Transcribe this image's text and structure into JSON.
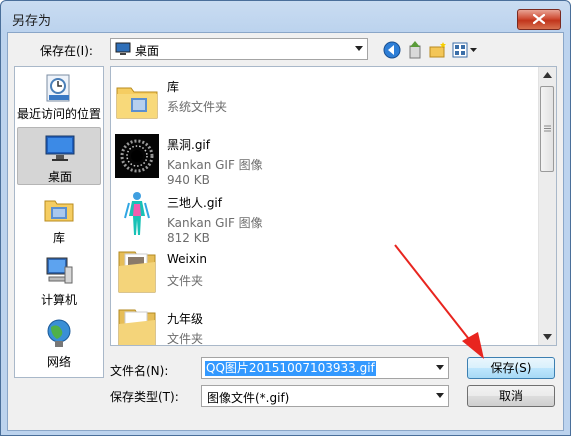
{
  "window": {
    "title": "另存为",
    "close_icon": "close-icon"
  },
  "location": {
    "label": "保存在(I):",
    "value": "桌面"
  },
  "toolbar": {
    "icons": [
      "back-icon",
      "up-folder-icon",
      "new-folder-icon",
      "view-menu-icon"
    ]
  },
  "places": [
    {
      "label": "最近访问的位置",
      "icon": "recent-places-icon",
      "selected": false
    },
    {
      "label": "桌面",
      "icon": "desktop-icon",
      "selected": true
    },
    {
      "label": "库",
      "icon": "library-icon",
      "selected": false
    },
    {
      "label": "计算机",
      "icon": "computer-icon",
      "selected": false
    },
    {
      "label": "网络",
      "icon": "network-icon",
      "selected": false
    }
  ],
  "files": [
    {
      "name": "库",
      "type": "系统文件夹",
      "size": "",
      "icon": "library-folder-icon"
    },
    {
      "name": "黑洞.gif",
      "type": "Kankan GIF 图像",
      "size": "940 KB",
      "icon": "black-hole-thumbnail"
    },
    {
      "name": "三地人.gif",
      "type": "Kankan GIF 图像",
      "size": "812 KB",
      "icon": "human-figure-thumbnail"
    },
    {
      "name": "Weixin",
      "type": "文件夹",
      "size": "",
      "icon": "folder-icon"
    },
    {
      "name": "九年级",
      "type": "文件夹",
      "size": "",
      "icon": "folder-icon"
    }
  ],
  "filename": {
    "label": "文件名(N):",
    "value": "QQ图片20151007103933.gif"
  },
  "filetype": {
    "label": "保存类型(T):",
    "value": "图像文件(*.gif)"
  },
  "buttons": {
    "save": "保存(S)",
    "cancel": "取消"
  },
  "colors": {
    "selection": "#3399ff",
    "arrow": "#e8251f"
  }
}
